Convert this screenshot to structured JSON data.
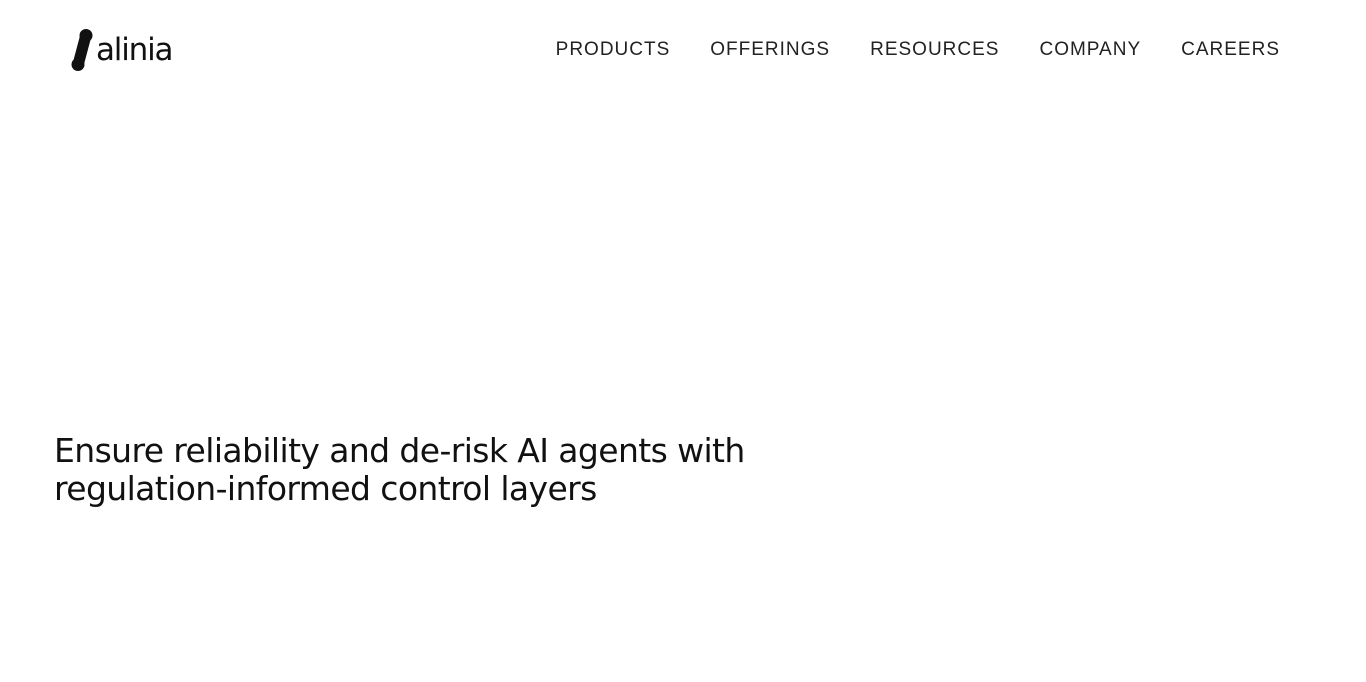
{
  "brand": {
    "name": "alinia",
    "logo_icon": "alinia-s-mark-icon",
    "color": "#111111"
  },
  "nav": {
    "items": [
      {
        "label": "PRODUCTS"
      },
      {
        "label": "OFFERINGS"
      },
      {
        "label": "RESOURCES"
      },
      {
        "label": "COMPANY"
      },
      {
        "label": "CAREERS"
      }
    ]
  },
  "hero": {
    "heading": "Ensure reliability and de-risk AI agents with regulation-informed control layers"
  },
  "colors": {
    "background": "#ffffff",
    "text": "#111111"
  }
}
